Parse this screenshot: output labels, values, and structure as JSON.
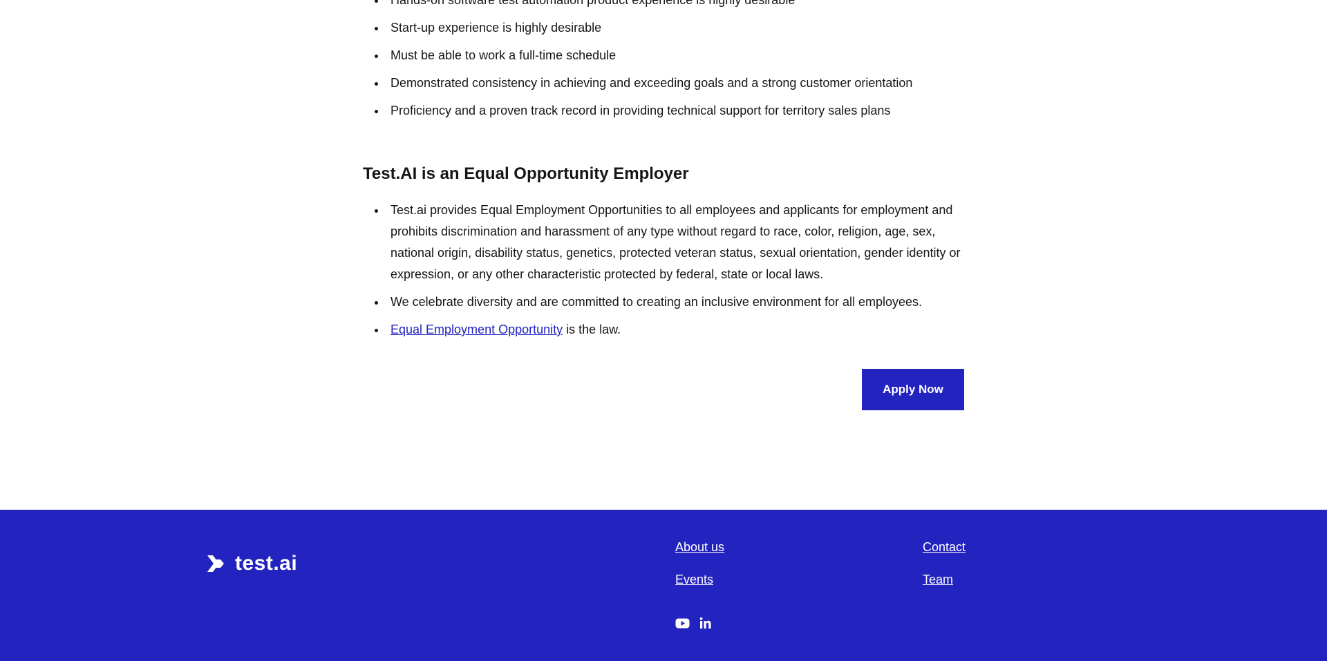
{
  "requirements": {
    "items": [
      "Hands-on software test automation product experience is highly desirable",
      "Start-up experience is highly desirable",
      "Must be able to work a full-time schedule",
      "Demonstrated consistency in achieving and exceeding goals and a strong customer orientation",
      "Proficiency and a proven track record in providing technical support for territory sales plans"
    ]
  },
  "eeo": {
    "heading": "Test.AI is an Equal Opportunity Employer",
    "item_1": "Test.ai provides Equal Employment Opportunities to all employees and applicants for employment and prohibits discrimination and harassment of any type without regard to race, color, religion, age, sex, national origin, disability status, genetics, protected veteran status, sexual orientation, gender identity or expression, or any other characteristic protected by federal, state or local laws.",
    "item_2": "We celebrate diversity and are committed to creating an inclusive environment for all employees.",
    "item_3_link": "Equal Employment Opportunity",
    "item_3_suffix": " is the law."
  },
  "apply_button": {
    "label": "Apply Now"
  },
  "footer": {
    "logo_text": "test.ai",
    "links": {
      "about": "About us",
      "events": "Events",
      "contact": "Contact",
      "team": "Team"
    },
    "social": [
      "youtube-icon",
      "linkedin-icon"
    ]
  },
  "colors": {
    "brand": "#2323c0",
    "text": "#161616",
    "background": "#ffffff"
  }
}
